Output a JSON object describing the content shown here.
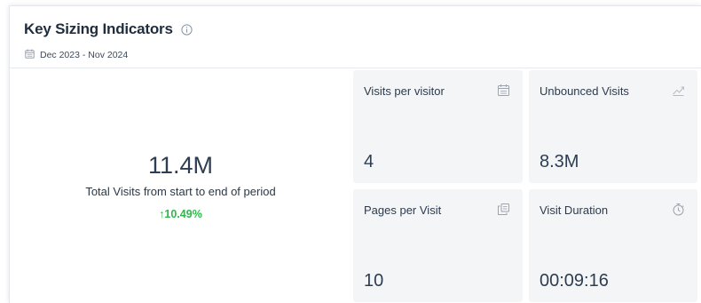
{
  "header": {
    "title": "Key Sizing Indicators",
    "date_range": "Dec 2023 - Nov 2024"
  },
  "summary": {
    "value": "11.4M",
    "label": "Total Visits from start to end of period",
    "change": "↑10.49%",
    "change_color": "#2eb84b"
  },
  "tiles": [
    {
      "label": "Visits per visitor",
      "value": "4",
      "icon": "calendar-icon"
    },
    {
      "label": "Unbounced Visits",
      "value": "8.3M",
      "icon": "trend-icon"
    },
    {
      "label": "Pages per Visit",
      "value": "10",
      "icon": "pages-icon"
    },
    {
      "label": "Visit Duration",
      "value": "00:09:16",
      "icon": "stopwatch-icon"
    }
  ]
}
